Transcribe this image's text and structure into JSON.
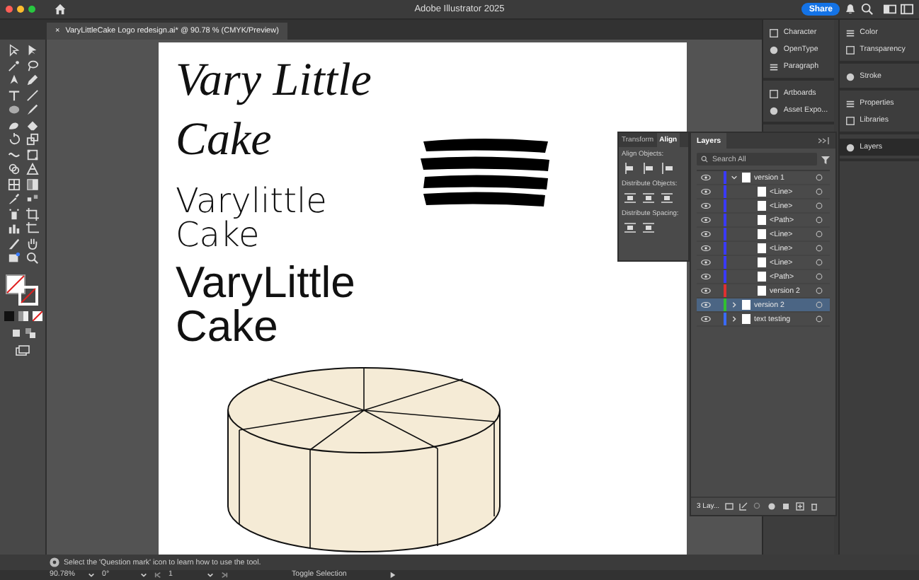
{
  "app": {
    "title": "Adobe Illustrator 2025",
    "share": "Share"
  },
  "document_tab": {
    "close": "×",
    "title": "VaryLittleCake Logo redesign.ai* @ 90.78 % (CMYK/Preview)"
  },
  "artboard": {
    "texts": [
      {
        "kind": "script",
        "lines": [
          "Vary Little",
          "Cake"
        ]
      },
      {
        "kind": "thin",
        "lines": [
          "Varylittle",
          "Cake"
        ]
      },
      {
        "kind": "bold",
        "lines": [
          "VaryLittle",
          "Cake"
        ]
      }
    ]
  },
  "dock_column_1": [
    {
      "items": [
        "Character",
        "OpenType",
        "Paragraph"
      ]
    },
    {
      "items": [
        "Artboards",
        "Asset Expo..."
      ]
    }
  ],
  "dock_column_2": [
    {
      "items": [
        {
          "label": "Color",
          "selected": false
        },
        {
          "label": "Transparency",
          "selected": false
        }
      ]
    },
    {
      "items": [
        {
          "label": "Stroke",
          "selected": false
        }
      ]
    },
    {
      "items": [
        {
          "label": "Properties",
          "selected": false
        },
        {
          "label": "Libraries",
          "selected": false
        }
      ]
    },
    {
      "items": [
        {
          "label": "Layers",
          "selected": true
        }
      ]
    }
  ],
  "align_panel": {
    "tabs": [
      {
        "label": "Transform",
        "selected": false
      },
      {
        "label": "Align",
        "selected": true
      }
    ],
    "sections": [
      "Align Objects:",
      "Distribute Objects:",
      "Distribute Spacing:"
    ]
  },
  "layers": {
    "tab": "Layers",
    "search": {
      "placeholder": "Search All"
    },
    "rows": [
      {
        "name": "version 1",
        "color": "#3a3aff",
        "expanded": true,
        "selected": false,
        "children": [
          {
            "name": "<Line>",
            "color": "#3a3aff"
          },
          {
            "name": "<Line>",
            "color": "#3a3aff"
          },
          {
            "name": "<Path>",
            "color": "#3a3aff"
          },
          {
            "name": "<Line>",
            "color": "#3a3aff"
          },
          {
            "name": "<Line>",
            "color": "#3a3aff"
          },
          {
            "name": "<Line>",
            "color": "#3a3aff"
          },
          {
            "name": "<Path>",
            "color": "#3a3aff"
          },
          {
            "name": "version 2",
            "color": "#e03030"
          }
        ]
      },
      {
        "name": "version 2",
        "color": "#30c030",
        "expanded": false,
        "selected": true
      },
      {
        "name": "text testing",
        "color": "#3a6aff",
        "expanded": false,
        "selected": false
      }
    ],
    "count": "3 Lay..."
  },
  "hint": "Select the 'Question mark' icon to learn how to use the tool.",
  "status_bar": {
    "zoom": "90.78%",
    "rotation": "0°",
    "artboard": "1",
    "action": "Toggle Selection"
  }
}
